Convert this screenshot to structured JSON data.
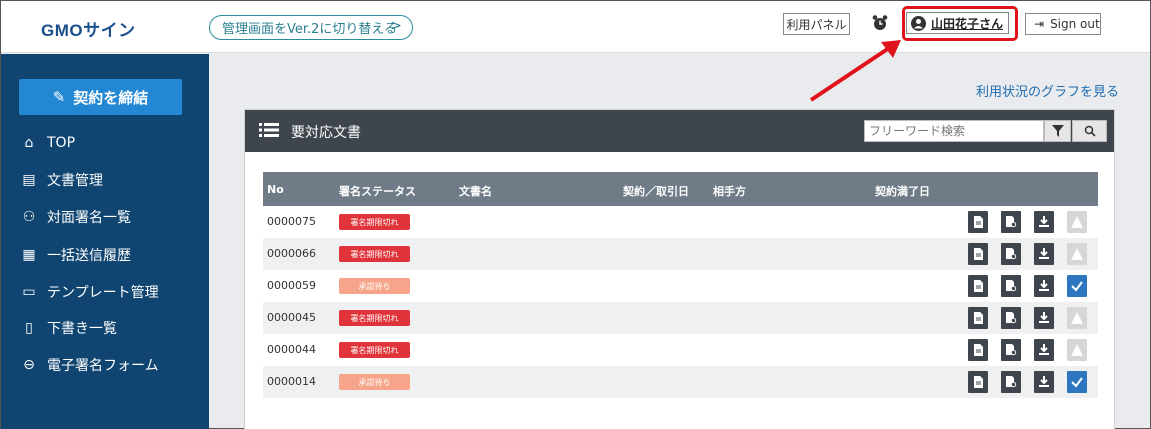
{
  "header": {
    "logo": "GMOサイン",
    "switch_label": "管理画面をVer.2に切り替える",
    "panel_label": "利用パネル",
    "user_name": "山田花子さん",
    "signout_label": "Sign out"
  },
  "sidebar": {
    "contract_label": "契約を締結",
    "items": [
      {
        "label": "TOP",
        "icon": "home-icon"
      },
      {
        "label": "文書管理",
        "icon": "document-icon"
      },
      {
        "label": "対面署名一覧",
        "icon": "face-to-face-icon"
      },
      {
        "label": "一括送信履歴",
        "icon": "bulk-send-icon"
      },
      {
        "label": "テンプレート管理",
        "icon": "template-icon"
      },
      {
        "label": "下書き一覧",
        "icon": "draft-icon"
      },
      {
        "label": "電子署名フォーム",
        "icon": "link-icon"
      }
    ]
  },
  "main": {
    "graph_link": "利用状況のグラフを見る",
    "card_title": "要対応文書",
    "search_placeholder": "フリーワード検索",
    "columns": [
      "No",
      "署名ステータス",
      "文書名",
      "契約／取引日",
      "相手方",
      "契約満了日"
    ],
    "rows": [
      {
        "no": "0000075",
        "status": "署名期限切れ",
        "status_color": "#e0343a",
        "last_action": "disabled"
      },
      {
        "no": "0000066",
        "status": "署名期限切れ",
        "status_color": "#e0343a",
        "last_action": "disabled"
      },
      {
        "no": "0000059",
        "status": "承認待ち",
        "status_color": "#f6a58a",
        "last_action": "check"
      },
      {
        "no": "0000045",
        "status": "署名期限切れ",
        "status_color": "#e0343a",
        "last_action": "disabled"
      },
      {
        "no": "0000044",
        "status": "署名期限切れ",
        "status_color": "#e0343a",
        "last_action": "disabled"
      },
      {
        "no": "0000014",
        "status": "承認待ち",
        "status_color": "#f6a58a",
        "last_action": "check"
      }
    ]
  },
  "colors": {
    "sidebar_bg": "#0f4570",
    "accent": "#2487d4",
    "highlight": "#e0141c"
  }
}
